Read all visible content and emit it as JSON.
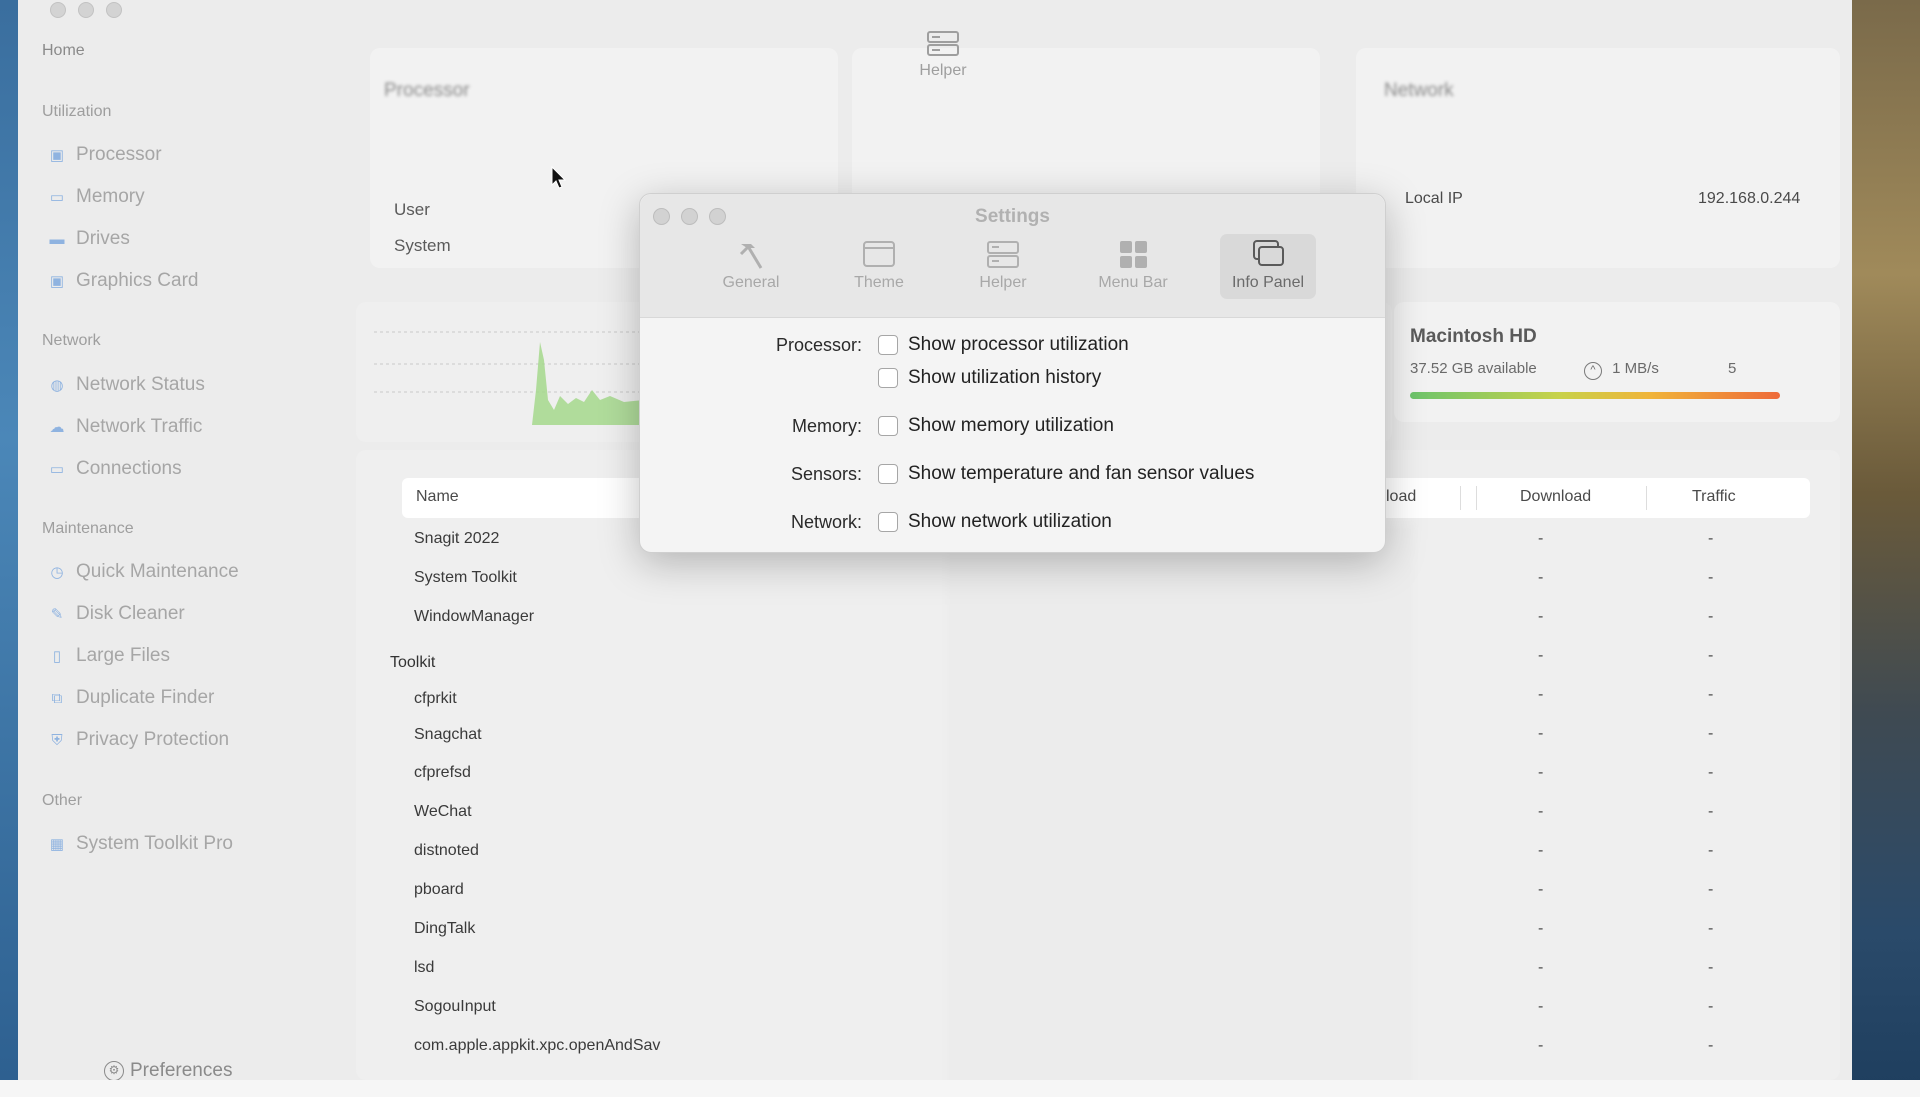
{
  "sidebar": {
    "home": "Home",
    "sections": {
      "utilization": "Utilization",
      "network": "Network",
      "maintenance": "Maintenance",
      "other": "Other"
    },
    "utilization_items": [
      "Processor",
      "Memory",
      "Drives",
      "Graphics Card"
    ],
    "network_items": [
      "Network Status",
      "Network Traffic",
      "Connections"
    ],
    "maintenance_items": [
      "Quick Maintenance",
      "Disk Cleaner",
      "Large Files",
      "Duplicate Finder",
      "Privacy Protection"
    ],
    "other_items": [
      "System Toolkit Pro"
    ],
    "preferences": "Preferences"
  },
  "main": {
    "processor_title": "Processor",
    "network_title": "Network",
    "cpu_user": "User",
    "cpu_system": "System",
    "local_ip_label": "Local IP",
    "local_ip_value": "192.168.0.244",
    "ghost_helper_label": "Helper",
    "disk": {
      "name": "Macintosh HD",
      "available": "37.52 GB available",
      "speed": "1 MB/s",
      "extra": "5"
    }
  },
  "table": {
    "headers": {
      "name": "Name",
      "upload": "load",
      "download": "Download",
      "traffic": "Traffic"
    },
    "rows": [
      "Snagit 2022",
      "System Toolkit",
      "WindowManager",
      "",
      "cfprkit",
      "Snagchat",
      "cfprefsd",
      "WeChat",
      "distnoted",
      "pboard",
      "DingTalk",
      "lsd",
      "SogouInput",
      "com.apple.appkit.xpc.openAndSav"
    ],
    "dash": "-",
    "tooltip": "Toolkit"
  },
  "settings": {
    "title": "Settings",
    "tabs": [
      "General",
      "Theme",
      "Helper",
      "Menu Bar",
      "Info Panel"
    ],
    "active_tab": "Info Panel",
    "labels": {
      "processor": "Processor:",
      "memory": "Memory:",
      "sensors": "Sensors:",
      "network": "Network:"
    },
    "options": {
      "processor_util": "Show processor utilization",
      "util_history": "Show utilization history",
      "memory_util": "Show memory utilization",
      "sensors": "Show temperature and fan sensor values",
      "network_util": "Show network utilization"
    }
  }
}
